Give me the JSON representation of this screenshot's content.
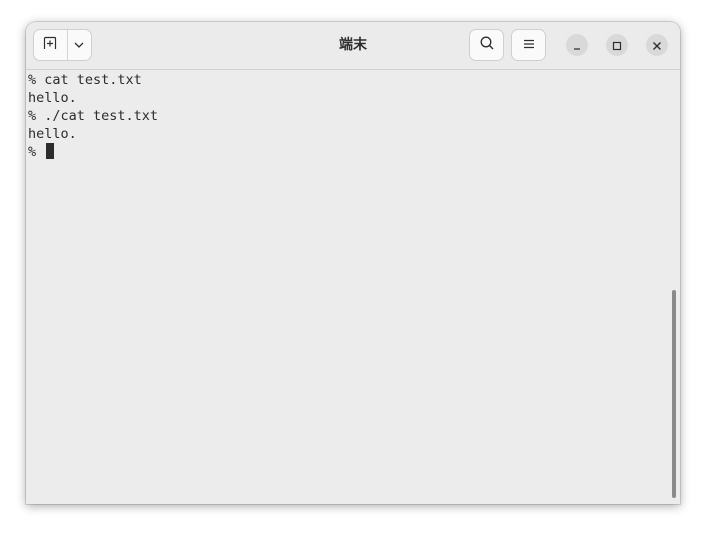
{
  "window": {
    "title": "端末"
  },
  "header": {
    "new_tab_icon": "new-tab-icon",
    "dropdown_icon": "chevron-down-icon",
    "search_icon": "search-icon",
    "menu_icon": "hamburger-menu-icon",
    "minimize_icon": "minimize-icon",
    "maximize_icon": "maximize-icon",
    "close_icon": "close-icon"
  },
  "terminal": {
    "lines": [
      "% cat test.txt",
      "hello.",
      "% ./cat test.txt",
      "hello."
    ],
    "prompt": "% "
  },
  "colors": {
    "background": "#ececec",
    "text": "#2c2c2c",
    "titlebar": "#ebebeb"
  }
}
